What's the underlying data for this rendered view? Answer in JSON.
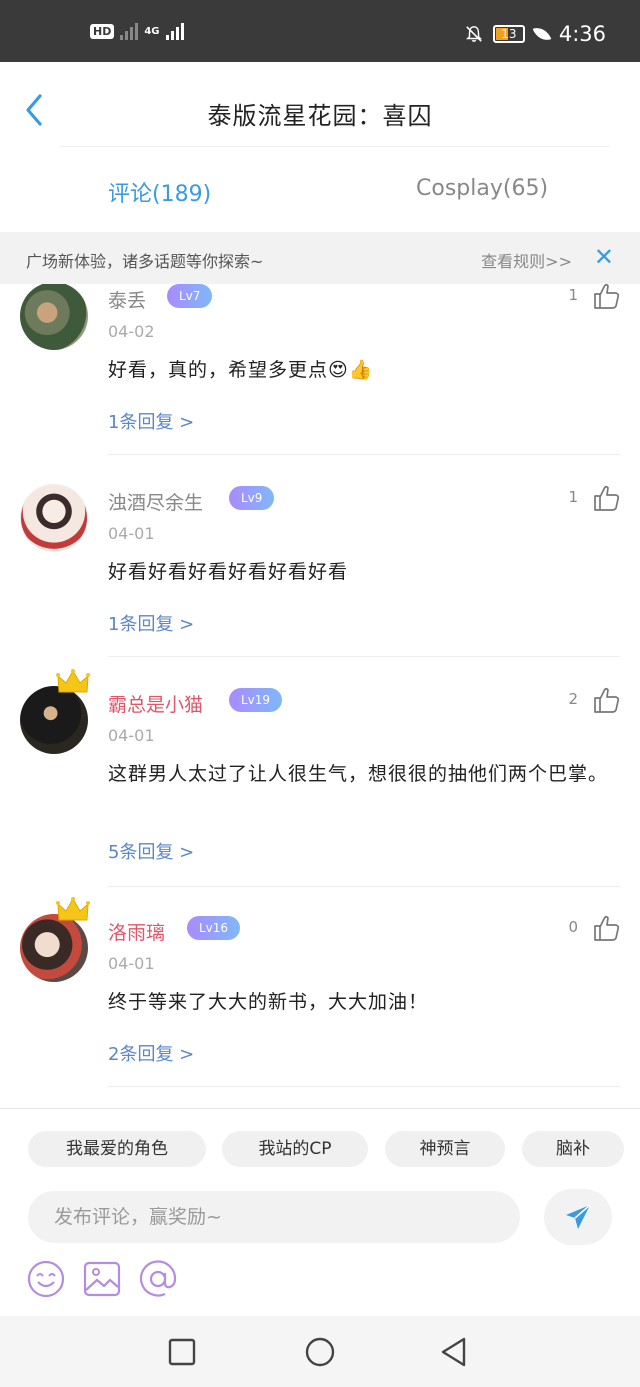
{
  "status_bar": {
    "hd_label": "HD",
    "network_label": "4G",
    "battery_level": "13",
    "time": "4:36"
  },
  "header": {
    "title": "泰版流星花园：喜囚",
    "back_icon": "chevron-left-icon"
  },
  "tabs": [
    {
      "label": "评论(189)",
      "active": true
    },
    {
      "label": "Cosplay(65)",
      "active": false
    }
  ],
  "notice": {
    "text": "广场新体验，诸多话题等你探索~",
    "rules_link": "查看规则>>",
    "close_icon": "close-icon"
  },
  "comments": [
    {
      "username": "泰丢",
      "level": "Lv7",
      "date": "04-02",
      "text": "好看，真的，希望多更点😍👍",
      "replies": "1条回复 >",
      "likes": "1",
      "vip": false
    },
    {
      "username": "浊酒尽余生",
      "level": "Lv9",
      "date": "04-01",
      "text": "好看好看好看好看好看好看",
      "replies": "1条回复 >",
      "likes": "1",
      "vip": false
    },
    {
      "username": "霸总是小猫",
      "level": "Lv19",
      "date": "04-01",
      "text": "这群男人太过了让人很生气，想很很的抽他们两个巴掌。",
      "replies": "5条回复 >",
      "likes": "2",
      "vip": true
    },
    {
      "username": "洛雨璃",
      "level": "Lv16",
      "date": "04-01",
      "text": "终于等来了大大的新书，大大加油！",
      "replies": "2条回复 >",
      "likes": "0",
      "vip": true
    }
  ],
  "panel": {
    "topics": [
      "我最爱的角色",
      "我站的CP",
      "神预言",
      "脑补"
    ],
    "input_placeholder": "发布评论，赢奖励~",
    "send_icon": "send-icon",
    "tools": [
      "emoji-icon",
      "image-icon",
      "mention-icon"
    ]
  },
  "navbar": {
    "buttons": [
      "recent-apps-icon",
      "home-icon",
      "back-triangle-icon"
    ]
  },
  "colors": {
    "accent": "#3a9be0",
    "vip_name": "#e0566a",
    "reply_link": "#5b86c8",
    "tool_icon": "#b48de0"
  }
}
